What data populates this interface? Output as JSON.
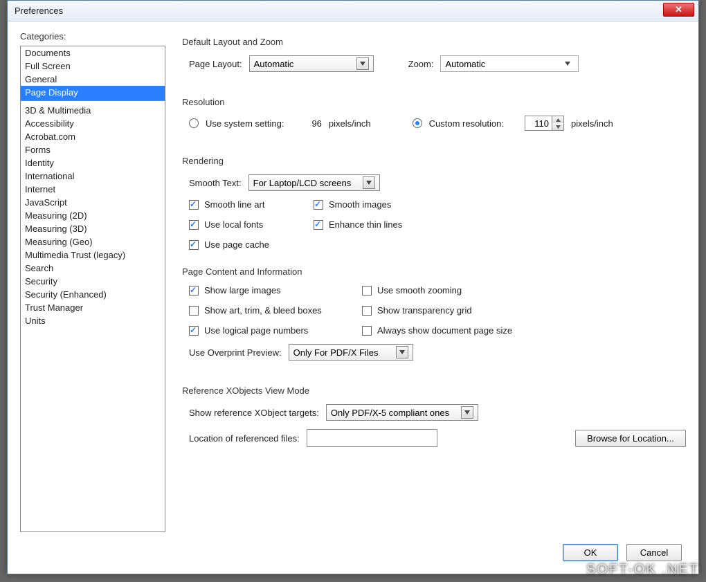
{
  "window": {
    "title": "Preferences"
  },
  "sidebar": {
    "label": "Categories:",
    "group1": [
      "Documents",
      "Full Screen",
      "General",
      "Page Display"
    ],
    "group2": [
      "3D & Multimedia",
      "Accessibility",
      "Acrobat.com",
      "Forms",
      "Identity",
      "International",
      "Internet",
      "JavaScript",
      "Measuring (2D)",
      "Measuring (3D)",
      "Measuring (Geo)",
      "Multimedia Trust (legacy)",
      "Search",
      "Security",
      "Security (Enhanced)",
      "Trust Manager",
      "Units"
    ],
    "selected": "Page Display"
  },
  "layoutZoom": {
    "title": "Default Layout and Zoom",
    "pageLayoutLabel": "Page Layout:",
    "pageLayoutValue": "Automatic",
    "zoomLabel": "Zoom:",
    "zoomValue": "Automatic"
  },
  "resolution": {
    "title": "Resolution",
    "useSystemLabel": "Use system setting:",
    "systemValue": "96",
    "unit": "pixels/inch",
    "customLabel": "Custom resolution:",
    "customValue": "110"
  },
  "rendering": {
    "title": "Rendering",
    "smoothTextLabel": "Smooth Text:",
    "smoothTextValue": "For Laptop/LCD screens",
    "smoothLineArt": "Smooth line art",
    "smoothImages": "Smooth images",
    "useLocalFonts": "Use local fonts",
    "enhanceThinLines": "Enhance thin lines",
    "usePageCache": "Use page cache"
  },
  "pageContent": {
    "title": "Page Content and Information",
    "showLargeImages": "Show large images",
    "useSmoothZooming": "Use smooth zooming",
    "showArtTrim": "Show art, trim, & bleed boxes",
    "showTransparency": "Show transparency grid",
    "useLogicalPageNums": "Use logical page numbers",
    "alwaysShowDocSize": "Always show document page size",
    "overprintLabel": "Use Overprint Preview:",
    "overprintValue": "Only For PDF/X Files"
  },
  "xobjects": {
    "title": "Reference XObjects View Mode",
    "showTargetsLabel": "Show reference XObject targets:",
    "showTargetsValue": "Only PDF/X-5 compliant ones",
    "locationLabel": "Location of referenced files:",
    "locationValue": "",
    "browseLabel": "Browse for Location..."
  },
  "footer": {
    "ok": "OK",
    "cancel": "Cancel"
  },
  "watermark": "SOFT-OK .NET"
}
